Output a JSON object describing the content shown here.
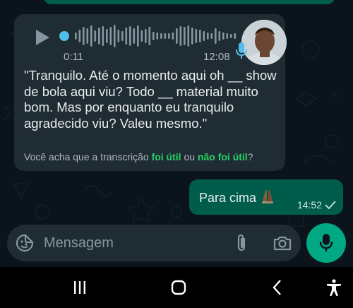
{
  "voice_message": {
    "elapsed": "0:11",
    "sent_time": "12:08",
    "transcription": "\"Tranquilo. Até o momento aqui oh __ show de bola aqui viu? Todo __ material muito bom. Mas por enquanto eu tranquilo agradecido viu? Valeu mesmo.\"",
    "feedback_prefix": "Você acha que a transcrição",
    "feedback_yes": "foi útil",
    "feedback_or": "ou",
    "feedback_no": "não foi útil",
    "feedback_suffix": "?"
  },
  "outgoing_message": {
    "text": "Para cima",
    "emoji": "folded-hands-emoji",
    "time": "14:52",
    "status": "sent-check-icon"
  },
  "composer": {
    "placeholder": "Mensagem",
    "value": ""
  },
  "colors": {
    "background": "#0b141a",
    "incoming_bubble": "#202c33",
    "outgoing_bubble": "#005c4b",
    "accent": "#00a884",
    "link": "#25d366",
    "progress": "#53bdeb"
  },
  "icons": [
    "play-icon",
    "microphone-badge-icon",
    "sticker-emoji-icon",
    "paperclip-icon",
    "camera-icon",
    "microphone-icon",
    "recents-icon",
    "home-icon",
    "back-icon",
    "accessibility-icon"
  ]
}
